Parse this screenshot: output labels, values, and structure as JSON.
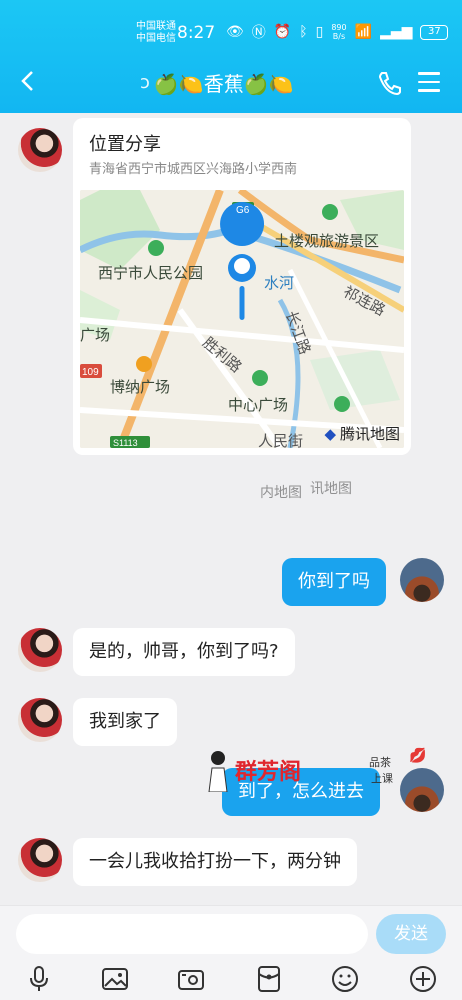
{
  "status_bar": {
    "carrier1": "中国联通",
    "carrier2": "中国电信",
    "time": "8:27",
    "net_speed_value": "890",
    "net_speed_unit": "B/s",
    "battery": "37"
  },
  "header": {
    "title": "🍏🍋香蕉🍏🍋"
  },
  "location_card": {
    "title": "位置分享",
    "address": "青海省西宁市城西区兴海路小学西南",
    "map_labels": {
      "park": "西宁市人民公园",
      "scenic": "土楼观旅游景区",
      "river": "水河",
      "road_qilian": "祁连路",
      "square_left": "广场",
      "bona": "博纳广场",
      "shengli": "胜利路",
      "zhongxin": "中心广场",
      "changjiang": "长江路",
      "renmin": "人民街",
      "g6": "G6",
      "s109": "109",
      "s1113": "S1113"
    },
    "credit": "腾讯地图"
  },
  "ghost_text": {
    "a": "内地图",
    "b": "讯地图"
  },
  "messages": [
    {
      "dir": "out",
      "text": "你到了吗"
    },
    {
      "dir": "in",
      "text": "是的，帅哥，你到了吗?"
    },
    {
      "dir": "in",
      "text": "我到家了"
    },
    {
      "dir": "out",
      "text": "到了，怎么进去"
    },
    {
      "dir": "in",
      "text": "一会儿我收拾打扮一下，两分钟"
    }
  ],
  "sticker": {
    "brand": "群芳阁",
    "tea": "品茶",
    "class": "上课"
  },
  "input": {
    "placeholder": "",
    "send_label": "发送"
  },
  "colors": {
    "header": "#12b6f2",
    "out_bubble": "#1aa3ee",
    "send_button": "#a9dcf8"
  },
  "icons": {
    "toolbar": [
      "microphone-icon",
      "image-icon",
      "camera-icon",
      "red-packet-icon",
      "emoji-icon",
      "plus-icon"
    ]
  }
}
